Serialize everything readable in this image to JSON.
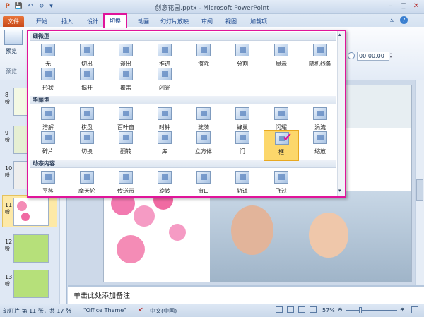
{
  "app": {
    "title": "创意花园.pptx - Microsoft PowerPoint"
  },
  "quick_access": {
    "save": "💾",
    "undo": "↶",
    "redo": "↻",
    "customize": "▾"
  },
  "tabs": [
    "文件",
    "开始",
    "插入",
    "设计",
    "切换",
    "动画",
    "幻灯片放映",
    "审阅",
    "视图",
    "加载项"
  ],
  "ribbon": {
    "preview_label": "预览",
    "preview_group": "预览",
    "duration_value": "00:00.00"
  },
  "gallery": {
    "sections": [
      {
        "title": "细微型",
        "items": [
          "无",
          "切出",
          "淡出",
          "推进",
          "擦除",
          "分割",
          "显示",
          "随机线条",
          "形状",
          "揭开",
          "覆盖",
          "闪光"
        ]
      },
      {
        "title": "华丽型",
        "items": [
          "溶解",
          "棋盘",
          "百叶窗",
          "时钟",
          "涟漪",
          "蜂巢",
          "闪耀",
          "涡流",
          "碎片",
          "切换",
          "翻转",
          "库",
          "立方体",
          "门",
          "框",
          "缩放"
        ]
      },
      {
        "title": "动态内容",
        "items": [
          "平移",
          "摩天轮",
          "传送带",
          "旋转",
          "窗口",
          "轨道",
          "飞过"
        ]
      }
    ],
    "selected_item": "框"
  },
  "slides_pane": [
    {
      "num": "8",
      "tag": "吩"
    },
    {
      "num": "9",
      "tag": "吩"
    },
    {
      "num": "10",
      "tag": "吩"
    },
    {
      "num": "11",
      "tag": "吩"
    },
    {
      "num": "12",
      "tag": "吩"
    },
    {
      "num": "13",
      "tag": "吩"
    }
  ],
  "notes": {
    "placeholder": "单击此处添加备注"
  },
  "status": {
    "slide_info": "幻灯片 第 11 张，共 17 张",
    "theme": "\"Office Theme\"",
    "language": "中文(中国)",
    "zoom": "57%"
  },
  "colors": {
    "highlight": "#e0149a",
    "file_tab": "#d95b24",
    "selected_thumb": "#fde9a7"
  }
}
